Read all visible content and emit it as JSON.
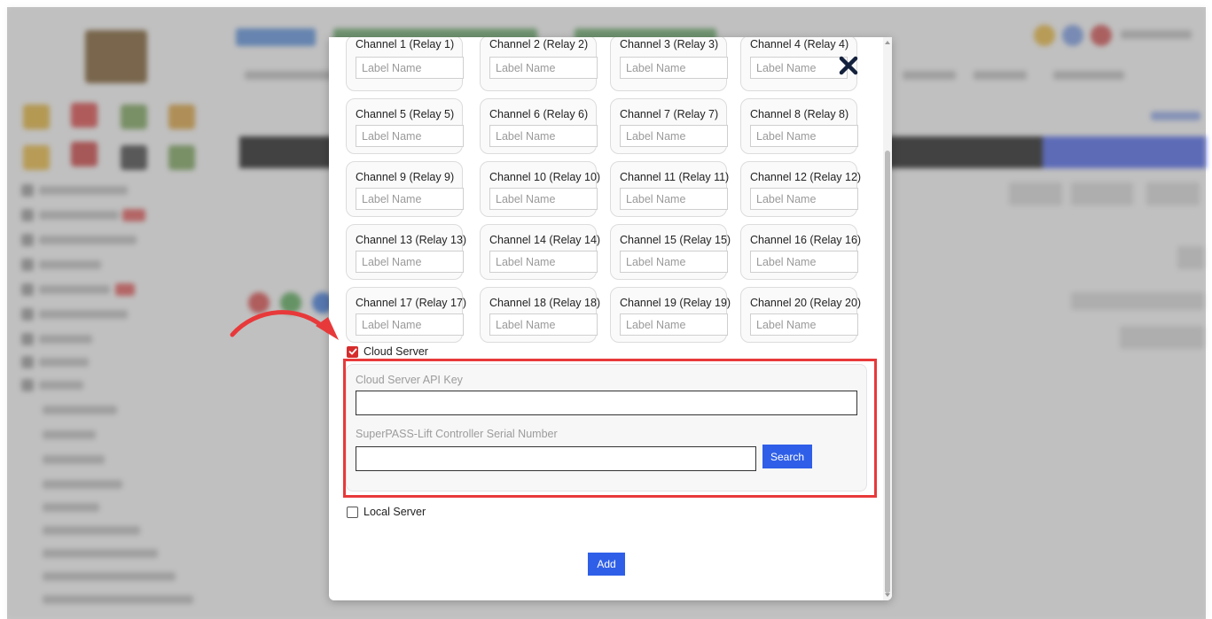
{
  "channels": [
    {
      "label": "Channel 1 (Relay 1)",
      "placeholder": "Label Name"
    },
    {
      "label": "Channel 2 (Relay 2)",
      "placeholder": "Label Name"
    },
    {
      "label": "Channel 3 (Relay 3)",
      "placeholder": "Label Name"
    },
    {
      "label": "Channel 4 (Relay 4)",
      "placeholder": "Label Name"
    },
    {
      "label": "Channel 5 (Relay 5)",
      "placeholder": "Label Name"
    },
    {
      "label": "Channel 6 (Relay 6)",
      "placeholder": "Label Name"
    },
    {
      "label": "Channel 7 (Relay 7)",
      "placeholder": "Label Name"
    },
    {
      "label": "Channel 8 (Relay 8)",
      "placeholder": "Label Name"
    },
    {
      "label": "Channel 9 (Relay 9)",
      "placeholder": "Label Name"
    },
    {
      "label": "Channel 10 (Relay 10)",
      "placeholder": "Label Name"
    },
    {
      "label": "Channel 11 (Relay 11)",
      "placeholder": "Label Name"
    },
    {
      "label": "Channel 12 (Relay 12)",
      "placeholder": "Label Name"
    },
    {
      "label": "Channel 13 (Relay 13)",
      "placeholder": "Label Name"
    },
    {
      "label": "Channel 14 (Relay 14)",
      "placeholder": "Label Name"
    },
    {
      "label": "Channel 15 (Relay 15)",
      "placeholder": "Label Name"
    },
    {
      "label": "Channel 16 (Relay 16)",
      "placeholder": "Label Name"
    },
    {
      "label": "Channel 17 (Relay 17)",
      "placeholder": "Label Name"
    },
    {
      "label": "Channel 18 (Relay 18)",
      "placeholder": "Label Name"
    },
    {
      "label": "Channel 19 (Relay 19)",
      "placeholder": "Label Name"
    },
    {
      "label": "Channel 20 (Relay 20)",
      "placeholder": "Label Name"
    }
  ],
  "cloud_server": {
    "label": "Cloud Server",
    "checked": true,
    "api_key_label": "Cloud Server API Key",
    "api_key_value": "",
    "serial_label": "SuperPASS-Lift Controller Serial Number",
    "serial_value": "",
    "search_label": "Search"
  },
  "local_server": {
    "label": "Local Server",
    "checked": false
  },
  "add_label": "Add",
  "icons": {
    "close": "close-icon",
    "check": "check-icon",
    "annotation_arrow": "curved-arrow-icon"
  },
  "colors": {
    "primary_button": "#2f5fe8",
    "highlight": "#e8393a",
    "checkbox_checked": "#d62c2c"
  }
}
